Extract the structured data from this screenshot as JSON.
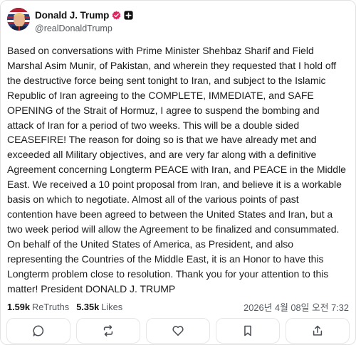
{
  "post": {
    "author": {
      "display_name": "Donald J. Trump",
      "handle": "@realDonaldTrump",
      "verified_color": "#e0245e"
    },
    "body_lines": [
      "Based on conversations with Prime Minister Shehbaz Sharif and Field",
      "Marshal Asim Munir, of Pakistan, and wherein they requested that I hold off",
      "the destructive force being sent tonight to Iran, and subject to the Islamic",
      "Republic of Iran agreeing to the COMPLETE, IMMEDIATE, and SAFE",
      "OPENING of the Strait of Hormuz, I agree to suspend the bombing and",
      "attack of Iran for a period of two weeks. This will be a double sided",
      "CEASEFIRE! The reason for doing so is that we have already met and",
      "exceeded all Military objectives, and are very far along with a definitive",
      "Agreement concerning Longterm PEACE with Iran, and PEACE in the Middle",
      "East. We received a 10 point proposal from Iran, and believe it is a workable",
      "basis on which to negotiate. Almost all of the various points of past",
      "contention have been agreed to between the United States and Iran, but a",
      "two week period will allow the Agreement to be finalized and consummated.",
      "On behalf of the United States of America, as President, and also",
      "representing the Countries of the Middle East, it is an Honor to have this",
      "Longterm problem close to resolution. Thank you for your attention to this",
      "matter! President DONALD J. TRUMP"
    ],
    "stats": {
      "retruths_count": "1.59k",
      "retruths_label": "ReTruths",
      "likes_count": "5.35k",
      "likes_label": "Likes"
    },
    "timestamp": "2026년 4월 08일 오전 7:32"
  },
  "actions": [
    {
      "icon": "reply-icon"
    },
    {
      "icon": "retruth-icon"
    },
    {
      "icon": "like-icon"
    },
    {
      "icon": "bookmark-icon"
    },
    {
      "icon": "share-icon"
    }
  ],
  "colors": {
    "text": "#1c1c1c",
    "muted": "#555a60",
    "icon": "#4a4f55",
    "border": "#e2e2e2"
  }
}
